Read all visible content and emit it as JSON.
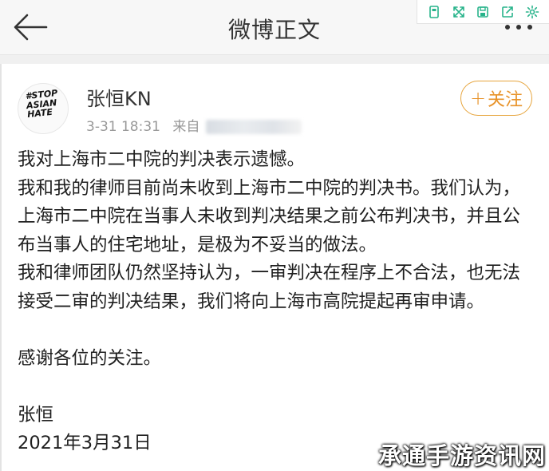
{
  "header": {
    "title": "微博正文",
    "back_icon": "arrow-left-icon",
    "more_icon": "more-dots-icon"
  },
  "toolbar": {
    "icons": [
      "copy-icon",
      "fullscreen-icon",
      "save-icon",
      "share-icon",
      "settings-icon"
    ],
    "accent": "#27b38a"
  },
  "post": {
    "author": "张恒KN",
    "avatar_text": [
      "#STOP",
      "ASIAN",
      "HATE"
    ],
    "time": "3-31 18:31",
    "source_prefix": "来自",
    "follow_label": "关注",
    "follow_color": "#e8932a",
    "paragraphs": [
      "我对上海市二中院的判决表示遗憾。",
      "我和我的律师目前尚未收到上海市二中院的判决书。我们认为，上海市二中院在当事人未收到判决结果之前公布判决书，并且公布当事人的住宅地址，是极为不妥当的做法。",
      "我和律师团队仍然坚持认为，一审判决在程序上不合法，也无法接受二审的判决结果，我们将向上海市高院提起再审申请。",
      "",
      "感谢各位的关注。",
      "",
      "张恒",
      "2021年3月31日"
    ]
  },
  "watermark": "承通手游资讯网"
}
